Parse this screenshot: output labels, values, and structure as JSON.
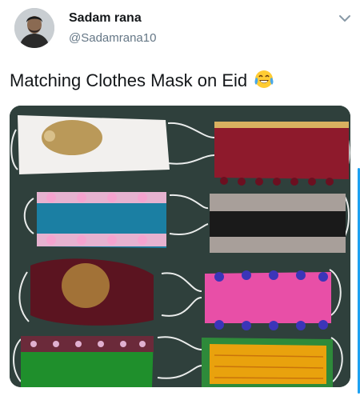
{
  "tweet": {
    "author_name": "Sadam rana",
    "author_handle": "@Sadamrana10",
    "text": "Matching Clothes Mask on Eid"
  },
  "icons": {
    "emoji": "face-with-tears-of-joy",
    "menu": "chevron-down-icon"
  },
  "photo": {
    "subject": "eight cloth face masks in pairs on a dark green surface",
    "mask_colors": [
      "#f2f0ee",
      "#8e1a2c",
      "#1b7fa3",
      "#1a1a1a",
      "#5b1420",
      "#e84fa7",
      "#1f8f2c",
      "#e9a20d"
    ]
  },
  "colors": {
    "accent": "#1da1f2",
    "text": "#14171a",
    "secondary_text": "#657786"
  }
}
